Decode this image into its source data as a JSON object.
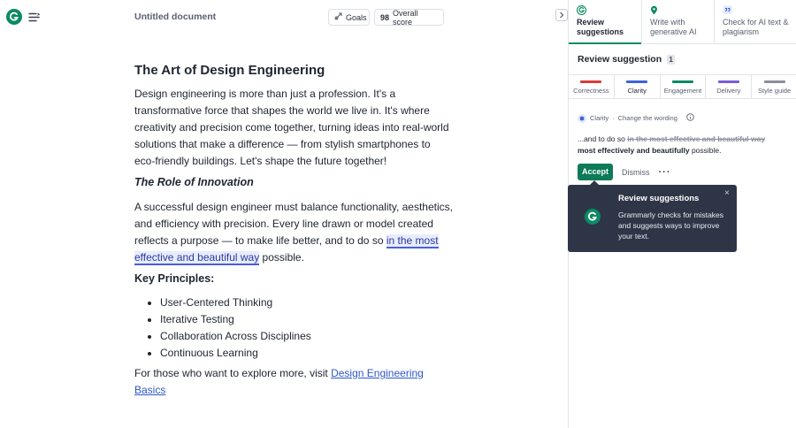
{
  "header": {
    "doc_title": "Untitled document",
    "goals_label": "Goals",
    "score_value": "98",
    "score_label": "Overall score"
  },
  "document": {
    "title": "The Art of Design Engineering",
    "intro": "Design engineering is more than just a profession. It's a transformative force that shapes the world we live in. It's where creativity and precision come together, turning ideas into real-world solutions that make a difference — from stylish smartphones to eco-friendly buildings. Let's shape the future together!",
    "section1_heading": "The Role of Innovation",
    "section1_text_before": "A successful design engineer must balance functionality, aesthetics, and efficiency with precision. Every line drawn or model created reflects a purpose — to make life better, and to do so ",
    "section1_highlight": "in the most effective and beautiful way",
    "section1_text_after": " possible.",
    "principles_heading": "Key Principles:",
    "principles": [
      "User-Centered Thinking",
      "Iterative Testing",
      "Collaboration Across Disciplines",
      "Continuous Learning"
    ],
    "closing_text": "For those who want to explore more, visit ",
    "closing_link": "Design Engineering Basics"
  },
  "panel": {
    "tabs": [
      {
        "label": "Review suggestions",
        "icon": "grammarly-icon",
        "active": true
      },
      {
        "label": "Write with generative AI",
        "icon": "pin-icon",
        "active": false
      },
      {
        "label": "Check for AI text & plagiarism",
        "icon": "quote-icon",
        "active": false
      }
    ],
    "review_heading": "Review suggestion",
    "review_count": "1",
    "categories": [
      {
        "label": "Correctness",
        "color": "#d93a3a"
      },
      {
        "label": "Clarity",
        "color": "#3f63d6"
      },
      {
        "label": "Engagement",
        "color": "#0d8a63"
      },
      {
        "label": "Delivery",
        "color": "#7b5bd6"
      },
      {
        "label": "Style guide",
        "color": "#8a8f9c"
      }
    ],
    "suggestion": {
      "category": "Clarity",
      "separator": "·",
      "action": "Change the wording",
      "prefix": "...and to do so ",
      "removed": "in the most effective and beautiful way",
      "added": "most effectively and beautifully",
      "suffix": " possible.",
      "accept_label": "Accept",
      "dismiss_label": "Dismiss",
      "more_label": "···"
    },
    "tooltip": {
      "title": "Review suggestions",
      "body": "Grammarly checks for mistakes and suggests ways to improve your text.",
      "close": "×"
    }
  }
}
